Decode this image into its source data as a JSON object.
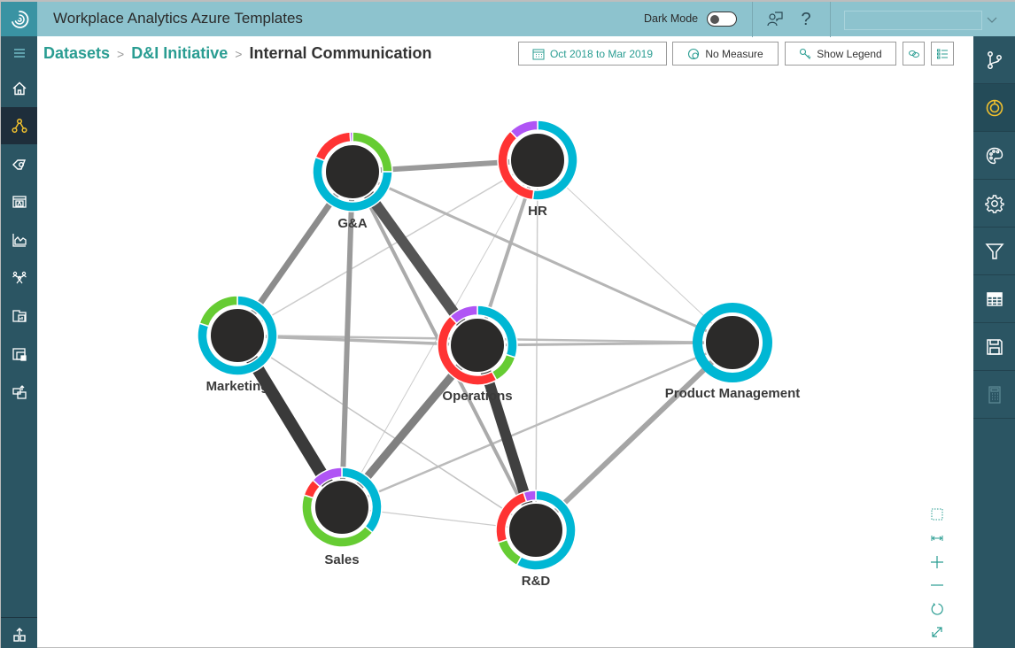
{
  "app": {
    "title": "Workplace Analytics Azure Templates",
    "dark_mode_label": "Dark Mode",
    "dark_mode_on": false
  },
  "header_icons": [
    {
      "name": "feedback-icon"
    },
    {
      "name": "help-icon",
      "glyph": "?"
    }
  ],
  "left_nav": [
    {
      "name": "menu-icon",
      "active": false
    },
    {
      "name": "home-icon",
      "active": false
    },
    {
      "name": "network-icon",
      "active": true
    },
    {
      "name": "tag-icon",
      "active": false
    },
    {
      "name": "profile-card-icon",
      "active": false
    },
    {
      "name": "area-chart-icon",
      "active": false
    },
    {
      "name": "people-network-icon",
      "active": false
    },
    {
      "name": "report-folder-icon",
      "active": false
    },
    {
      "name": "window-icon",
      "active": false
    },
    {
      "name": "export-icon",
      "active": false
    },
    {
      "name": "upload-icon",
      "active": false
    }
  ],
  "right_nav": [
    {
      "name": "branch-icon",
      "active": false
    },
    {
      "name": "donut-icon",
      "active": true
    },
    {
      "name": "palette-icon",
      "active": false
    },
    {
      "name": "settings-icon",
      "active": false
    },
    {
      "name": "filter-icon",
      "active": false
    },
    {
      "name": "table-icon",
      "active": false
    },
    {
      "name": "save-icon",
      "active": false
    },
    {
      "name": "calculator-icon",
      "active": false,
      "disabled": true
    }
  ],
  "breadcrumb": {
    "items": [
      "Datasets",
      "D&I Initiative"
    ],
    "current": "Internal Communication",
    "separator": ">"
  },
  "toolbar": {
    "date_range": "Oct 2018 to Mar 2019",
    "measure": "No Measure",
    "legend": "Show Legend"
  },
  "zoom_controls": [
    "select-box-icon",
    "fit-width-icon",
    "zoom-in-icon",
    "zoom-out-icon",
    "reset-icon",
    "expand-icon"
  ],
  "colors": {
    "accent": "#2A9D92",
    "topbar": "#8DC3CE",
    "sidebar": "#2B5563",
    "active_icon": "#F2C12E",
    "segment_cyan": "#00B7D4",
    "segment_green": "#66CC33",
    "segment_red": "#FF3333",
    "segment_purple": "#B055F5",
    "node_fill": "#2B2A29"
  },
  "graph": {
    "nodes": [
      {
        "id": "ga",
        "label": "G&A",
        "segments": [
          {
            "color": "#66CC33",
            "value": 0.25
          },
          {
            "color": "#00B7D4",
            "value": 0.56
          },
          {
            "color": "#FF3333",
            "value": 0.18
          },
          {
            "color": "#B055F5",
            "value": 0.01
          }
        ]
      },
      {
        "id": "hr",
        "label": "HR",
        "segments": [
          {
            "color": "#00B7D4",
            "value": 0.52
          },
          {
            "color": "#FF3333",
            "value": 0.36
          },
          {
            "color": "#B055F5",
            "value": 0.12
          }
        ]
      },
      {
        "id": "mkt",
        "label": "Marketing",
        "segments": [
          {
            "color": "#00B7D4",
            "value": 0.8
          },
          {
            "color": "#66CC33",
            "value": 0.2
          }
        ]
      },
      {
        "id": "ops",
        "label": "Operations",
        "segments": [
          {
            "color": "#00B7D4",
            "value": 0.3
          },
          {
            "color": "#66CC33",
            "value": 0.12
          },
          {
            "color": "#FF3333",
            "value": 0.46
          },
          {
            "color": "#B055F5",
            "value": 0.12
          }
        ]
      },
      {
        "id": "pm",
        "label": "Product Management",
        "segments": [
          {
            "color": "#00B7D4",
            "value": 1.0
          }
        ]
      },
      {
        "id": "sales",
        "label": "Sales",
        "segments": [
          {
            "color": "#00B7D4",
            "value": 0.36
          },
          {
            "color": "#66CC33",
            "value": 0.44
          },
          {
            "color": "#FF3333",
            "value": 0.07
          },
          {
            "color": "#B055F5",
            "value": 0.13
          }
        ]
      },
      {
        "id": "rd",
        "label": "R&D",
        "segments": [
          {
            "color": "#00B7D4",
            "value": 0.58
          },
          {
            "color": "#66CC33",
            "value": 0.12
          },
          {
            "color": "#FF3333",
            "value": 0.25
          },
          {
            "color": "#B055F5",
            "value": 0.05
          }
        ]
      }
    ],
    "edges": [
      {
        "from": "ga",
        "to": "hr",
        "weight": 6,
        "shade": "#9a9a9a"
      },
      {
        "from": "ga",
        "to": "mkt",
        "weight": 7,
        "shade": "#8c8c8c"
      },
      {
        "from": "ga",
        "to": "ops",
        "weight": 12,
        "shade": "#555555"
      },
      {
        "from": "ga",
        "to": "sales",
        "weight": 6,
        "shade": "#9a9a9a"
      },
      {
        "from": "ga",
        "to": "rd",
        "weight": 4,
        "shade": "#aaaaaa"
      },
      {
        "from": "ga",
        "to": "pm",
        "weight": 3,
        "shade": "#b5b5b5"
      },
      {
        "from": "hr",
        "to": "ops",
        "weight": 4,
        "shade": "#b0b0b0"
      },
      {
        "from": "hr",
        "to": "mkt",
        "weight": 1.5,
        "shade": "#cccccc"
      },
      {
        "from": "hr",
        "to": "pm",
        "weight": 1,
        "shade": "#cccccc"
      },
      {
        "from": "hr",
        "to": "rd",
        "weight": 1.5,
        "shade": "#cccccc"
      },
      {
        "from": "hr",
        "to": "sales",
        "weight": 1,
        "shade": "#cccccc"
      },
      {
        "from": "mkt",
        "to": "ops",
        "weight": 3.5,
        "shade": "#b5b5b5"
      },
      {
        "from": "mkt",
        "to": "pm",
        "weight": 2.5,
        "shade": "#bbbbbb"
      },
      {
        "from": "mkt",
        "to": "sales",
        "weight": 14,
        "shade": "#3a3a3a"
      },
      {
        "from": "mkt",
        "to": "rd",
        "weight": 1.5,
        "shade": "#c4c4c4"
      },
      {
        "from": "ops",
        "to": "pm",
        "weight": 3,
        "shade": "#b5b5b5"
      },
      {
        "from": "ops",
        "to": "sales",
        "weight": 9,
        "shade": "#808080"
      },
      {
        "from": "ops",
        "to": "rd",
        "weight": 12,
        "shade": "#404040"
      },
      {
        "from": "sales",
        "to": "pm",
        "weight": 2.5,
        "shade": "#bbbbbb"
      },
      {
        "from": "sales",
        "to": "rd",
        "weight": 1.2,
        "shade": "#cccccc"
      },
      {
        "from": "rd",
        "to": "pm",
        "weight": 6,
        "shade": "#a5a5a5"
      }
    ]
  }
}
